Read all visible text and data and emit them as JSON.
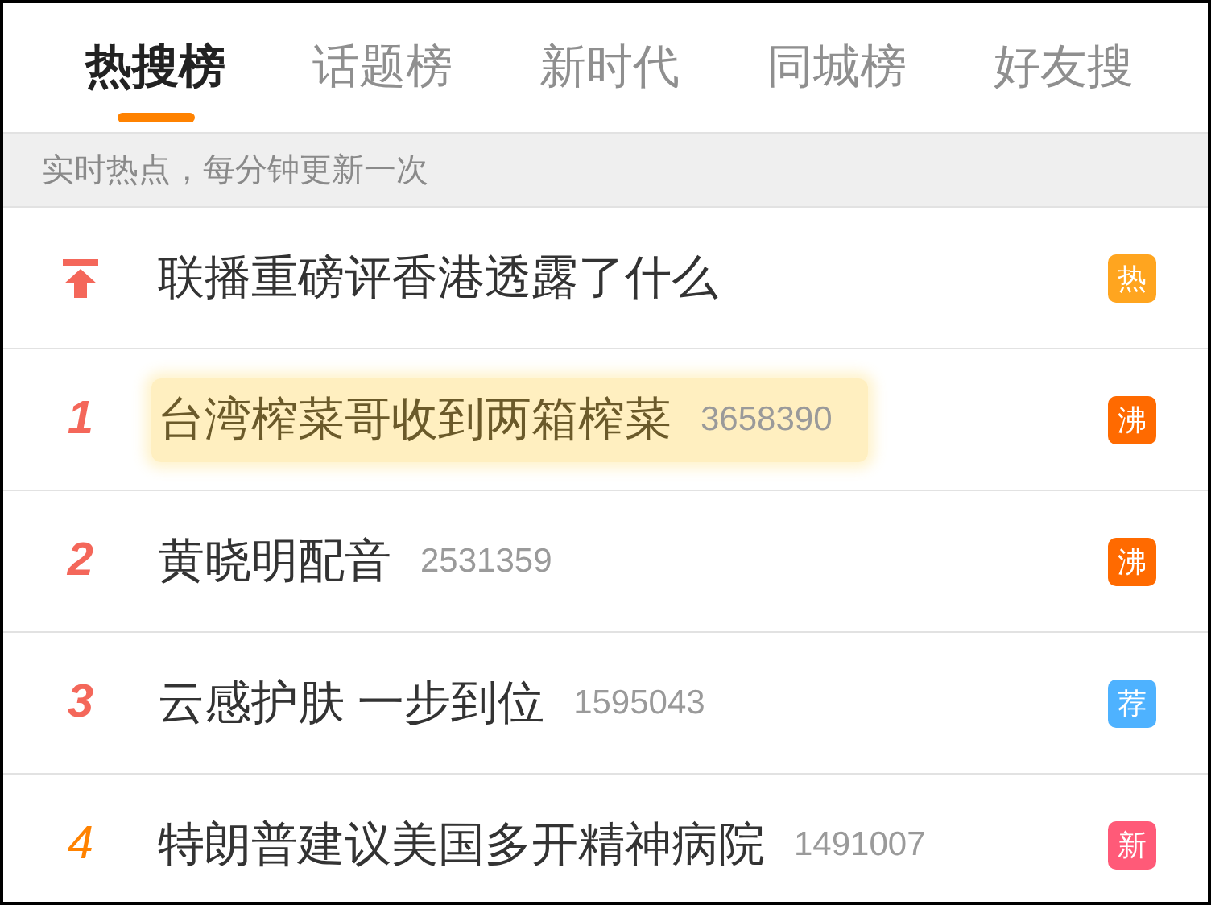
{
  "tabs": [
    {
      "label": "热搜榜",
      "selected": true
    },
    {
      "label": "话题榜",
      "selected": false
    },
    {
      "label": "新时代",
      "selected": false
    },
    {
      "label": "同城榜",
      "selected": false
    },
    {
      "label": "好友搜",
      "selected": false
    }
  ],
  "notice": "实时热点，每分钟更新一次",
  "rows": [
    {
      "kind": "pinned",
      "title": "联播重磅评香港透露了什么",
      "highlighted": false,
      "badge": {
        "text": "热",
        "color": "#ffa51f"
      }
    },
    {
      "kind": "ranked",
      "rank": {
        "text": "1",
        "color": "#f4675a"
      },
      "title": "台湾榨菜哥收到两箱榨菜",
      "count": "3658390",
      "highlighted": true,
      "badge": {
        "text": "沸",
        "color": "#ff6a00"
      }
    },
    {
      "kind": "ranked",
      "rank": {
        "text": "2",
        "color": "#f4675a"
      },
      "title": "黄晓明配音",
      "count": "2531359",
      "highlighted": false,
      "badge": {
        "text": "沸",
        "color": "#ff6a00"
      }
    },
    {
      "kind": "ranked",
      "rank": {
        "text": "3",
        "color": "#f4675a"
      },
      "title": "云感护肤 一步到位",
      "count": "1595043",
      "highlighted": false,
      "badge": {
        "text": "荐",
        "color": "#4eb2ff"
      }
    },
    {
      "kind": "ranked",
      "rank": {
        "text": "4",
        "color": "#ff8200"
      },
      "title": "特朗普建议美国多开精神病院",
      "count": "1491007",
      "highlighted": false,
      "badge": {
        "text": "新",
        "color": "#ff5a78"
      }
    }
  ]
}
